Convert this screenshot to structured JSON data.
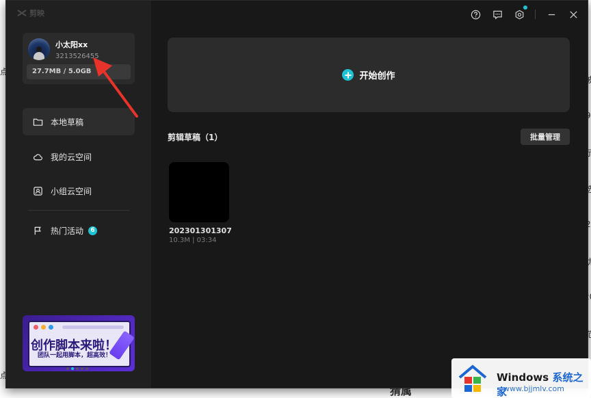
{
  "background": {
    "right_fragments": [
      "波",
      "9",
      "示",
      "选",
      "2",
      "优",
      "20",
      "范",
      "点"
    ],
    "left_fragments": [
      "点",
      "点"
    ],
    "bottom_text": "猜属"
  },
  "app": {
    "logo_text": "剪映"
  },
  "profile": {
    "username": "小太阳xx",
    "user_id": "3213526455",
    "storage": "27.7MB / 5.0GB"
  },
  "sidebar": {
    "items": [
      {
        "label": "本地草稿",
        "icon": "folder-icon"
      },
      {
        "label": "我的云空间",
        "icon": "cloud-icon"
      },
      {
        "label": "小组云空间",
        "icon": "team-cloud-icon"
      },
      {
        "label": "热门活动",
        "icon": "flag-icon",
        "badge": "6"
      }
    ]
  },
  "banner": {
    "title": "创作脚本来啦！",
    "subtitle": "团队一起用脚本，超高效！"
  },
  "main": {
    "create_label": "开始创作",
    "section_title": "剪辑草稿（1）",
    "batch_label": "批量管理",
    "drafts": [
      {
        "name": "202301301307",
        "meta": "10.3M | 03:34"
      }
    ]
  },
  "watermark": {
    "title_black": "Windows",
    "title_blue": "系统之家",
    "url": "www.bjjmlv.com"
  },
  "colors": {
    "accent": "#1fc3d4",
    "window_bg": "#181818",
    "sidebar_bg": "#202020",
    "arrow_red": "#e8332a"
  }
}
